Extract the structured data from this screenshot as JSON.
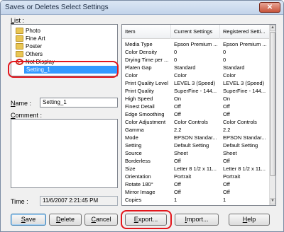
{
  "window": {
    "title": "Saves or Deletes Select Settings",
    "close_label": "✕"
  },
  "list": {
    "label_prefix": "L",
    "label_rest": "ist :",
    "items": [
      {
        "label": "Photo",
        "icon": "folder-icon"
      },
      {
        "label": "Fine Art",
        "icon": "folder-icon"
      },
      {
        "label": "Poster",
        "icon": "folder-icon"
      },
      {
        "label": "Others",
        "icon": "folder-icon"
      },
      {
        "label": "Not Display",
        "icon": "no-entry-icon"
      },
      {
        "label": "Setting_1",
        "icon": "none"
      }
    ],
    "selected": "Setting_1"
  },
  "name": {
    "label_prefix": "N",
    "label_rest": "ame :",
    "value": "Setting_1"
  },
  "comment": {
    "label_prefix": "C",
    "label_rest": "omment :",
    "value": ""
  },
  "time": {
    "label": "Time :",
    "value": "11/6/2007 2:21:45 PM"
  },
  "buttons": {
    "save": {
      "u": "S",
      "rest": "ave"
    },
    "delete": {
      "u": "D",
      "rest": "elete"
    },
    "cancel": {
      "u": "C",
      "rest": "ancel"
    },
    "export": {
      "u": "E",
      "rest": "xport..."
    },
    "import": {
      "u": "I",
      "rest": "mport..."
    },
    "help": {
      "u": "H",
      "rest": "elp"
    }
  },
  "table": {
    "headers": [
      "Item",
      "Current Settings",
      "Registered Setti..."
    ],
    "rows": [
      [
        "Media Type",
        "Epson Premium ...",
        "Epson Premium ..."
      ],
      [
        "Color Density",
        "0",
        "0"
      ],
      [
        "Drying Time per ...",
        "0",
        "0"
      ],
      [
        "Platen Gap",
        "Standard",
        "Standard"
      ],
      [
        "Color",
        "Color",
        "Color"
      ],
      [
        "Print Quality Level",
        "LEVEL 3 (Speed)",
        "LEVEL 3 (Speed)"
      ],
      [
        "Print Quality",
        "SuperFine - 144...",
        "SuperFine - 144..."
      ],
      [
        "High Speed",
        "On",
        "On"
      ],
      [
        "Finest Detail",
        "Off",
        "Off"
      ],
      [
        "Edge Smoothing",
        "Off",
        "Off"
      ],
      [
        "Color Adjustment",
        "Color Controls",
        "Color Controls"
      ],
      [
        "Gamma",
        "2.2",
        "2.2"
      ],
      [
        "Mode",
        "EPSON Standar...",
        "EPSON Standar..."
      ],
      [
        "Setting",
        "Default Setting",
        "Default Setting"
      ],
      [
        "Source",
        "Sheet",
        "Sheet"
      ],
      [
        "Borderless",
        "Off",
        "Off"
      ],
      [
        "Size",
        "Letter 8 1/2 x 11...",
        "Letter 8 1/2 x 11..."
      ],
      [
        "Orientation",
        "Portrait",
        "Portrait"
      ],
      [
        "Rotate 180°",
        "Off",
        "Off"
      ],
      [
        "Mirror Image",
        "Off",
        "Off"
      ],
      [
        "Copies",
        "1",
        "1"
      ]
    ]
  },
  "scrollbar": {
    "up": "▲",
    "down": "▼"
  }
}
